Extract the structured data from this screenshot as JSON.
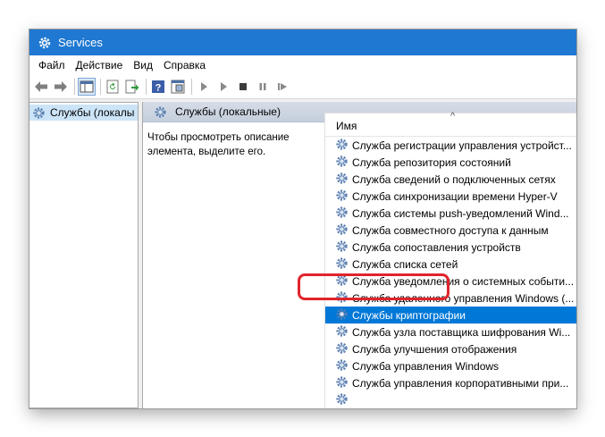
{
  "window": {
    "title": "Services"
  },
  "menu": [
    "Файл",
    "Действие",
    "Вид",
    "Справка"
  ],
  "toolbar": {
    "icons": [
      "back-arrow-icon",
      "forward-arrow-icon",
      "console-tree-icon",
      "refresh-icon",
      "export-list-icon",
      "help-icon",
      "properties-icon",
      "start-service-icon",
      "start-alt-icon",
      "stop-service-icon",
      "pause-service-icon",
      "restart-service-icon"
    ]
  },
  "tree": {
    "root_label": "Службы (локалы"
  },
  "main": {
    "header_title": "Службы (локальные)",
    "description": "Чтобы просмотреть описание элемента, выделите его.",
    "sort_caret": "^",
    "column_name": "Имя",
    "services": [
      "Служба регистрации управления устройст...",
      "Служба репозитория состояний",
      "Служба сведений о подключенных сетях",
      "Служба синхронизации времени Hyper-V",
      "Служба системы push-уведомлений Wind...",
      "Служба совместного доступа к данным",
      "Служба сопоставления устройств",
      "Служба списка сетей",
      "Служба уведомления о системных событи...",
      "Служба удаленного управления Windows (...",
      "Службы криптографии",
      "Служба узла поставщика шифрования Wi...",
      "Служба улучшения отображения",
      "Служба управления Windows",
      "Служба управления корпоративными при...",
      ""
    ],
    "selected_index": 10
  },
  "colors": {
    "titlebar": "#1f78d1",
    "selection": "#0078d7",
    "highlight_ring": "#e0242c"
  }
}
